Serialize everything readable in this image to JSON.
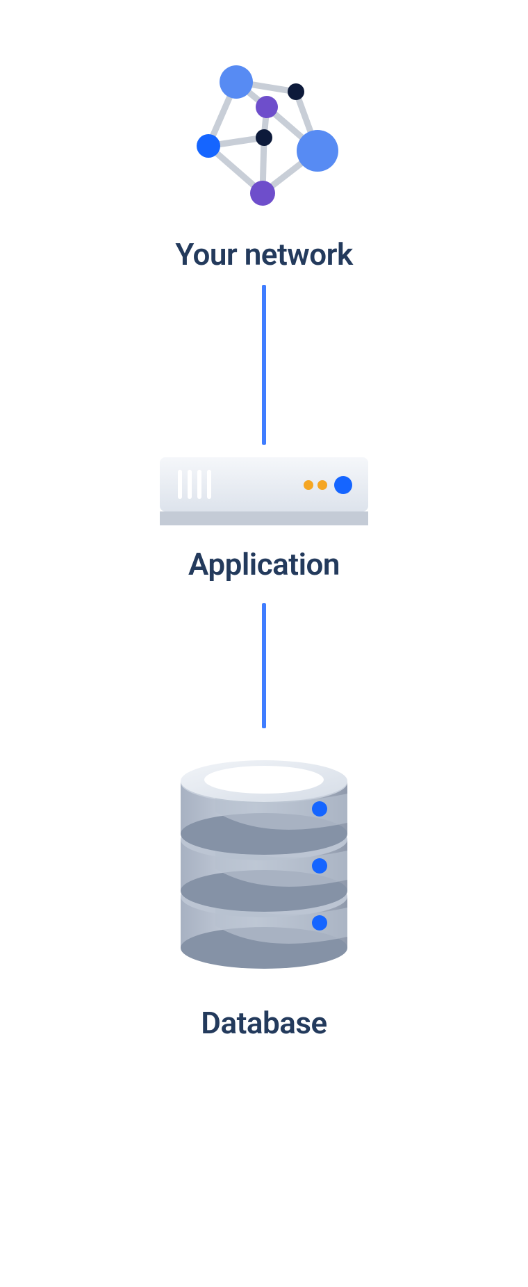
{
  "diagram": {
    "nodes": [
      {
        "id": "network",
        "label": "Your network",
        "icon": "network-graph-icon"
      },
      {
        "id": "application",
        "label": "Application",
        "icon": "server-box-icon"
      },
      {
        "id": "database",
        "label": "Database",
        "icon": "database-cylinder-icon"
      }
    ],
    "connectors": [
      {
        "from": "network",
        "to": "application"
      },
      {
        "from": "application",
        "to": "database"
      }
    ],
    "palette": {
      "label_color": "#233a5c",
      "connector_color": "#3f7dff",
      "blue_light": "#578bf3",
      "blue_bright": "#1565ff",
      "purple": "#6e4ecb",
      "navy": "#0d1a3a",
      "orange": "#f5a623",
      "grey_light": "#ecf0f5",
      "grey_mid": "#c4cbd6",
      "grey_dark": "#9aa3b2"
    }
  }
}
